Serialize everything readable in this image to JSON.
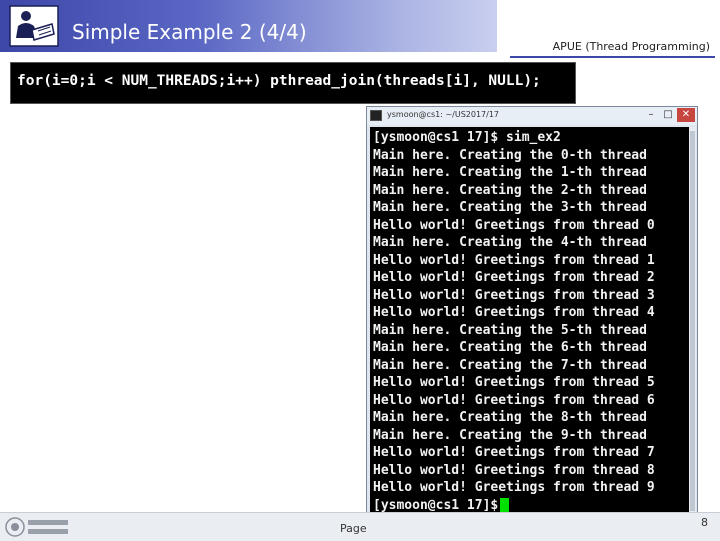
{
  "slide": {
    "title": "Simple Example 2 (4/4)",
    "subject": "APUE (Thread Programming)"
  },
  "code_banner": {
    "code": "for(i=0;i < NUM_THREADS;i++) pthread_join(threads[i], NULL);"
  },
  "terminal": {
    "window_title": "ysmoon@cs1: ~/US2017/17",
    "buttons": {
      "minimize": "–",
      "maximize": "□",
      "close": "✕"
    },
    "lines": [
      "[ysmoon@cs1 17]$ sim_ex2",
      "Main here. Creating the 0-th thread",
      "Main here. Creating the 1-th thread",
      "Main here. Creating the 2-th thread",
      "Main here. Creating the 3-th thread",
      "Hello world! Greetings from thread 0",
      "Main here. Creating the 4-th thread",
      "Hello world! Greetings from thread 1",
      "Hello world! Greetings from thread 2",
      "Hello world! Greetings from thread 3",
      "Hello world! Greetings from thread 4",
      "Main here. Creating the 5-th thread",
      "Main here. Creating the 6-th thread",
      "Main here. Creating the 7-th thread",
      "Hello world! Greetings from thread 5",
      "Hello world! Greetings from thread 6",
      "Main here. Creating the 8-th thread",
      "Main here. Creating the 9-th thread",
      "Hello world! Greetings from thread 7",
      "Hello world! Greetings from thread 8",
      "Hello world! Greetings from thread 9",
      "[ysmoon@cs1 17]$"
    ],
    "cursor_color": "#00e000"
  },
  "footer": {
    "page_label": "Page",
    "page_number": "8"
  },
  "colors": {
    "title_bar": "#3d47a8",
    "terminal_bg": "#000000",
    "terminal_text": "#f2f2f2"
  }
}
